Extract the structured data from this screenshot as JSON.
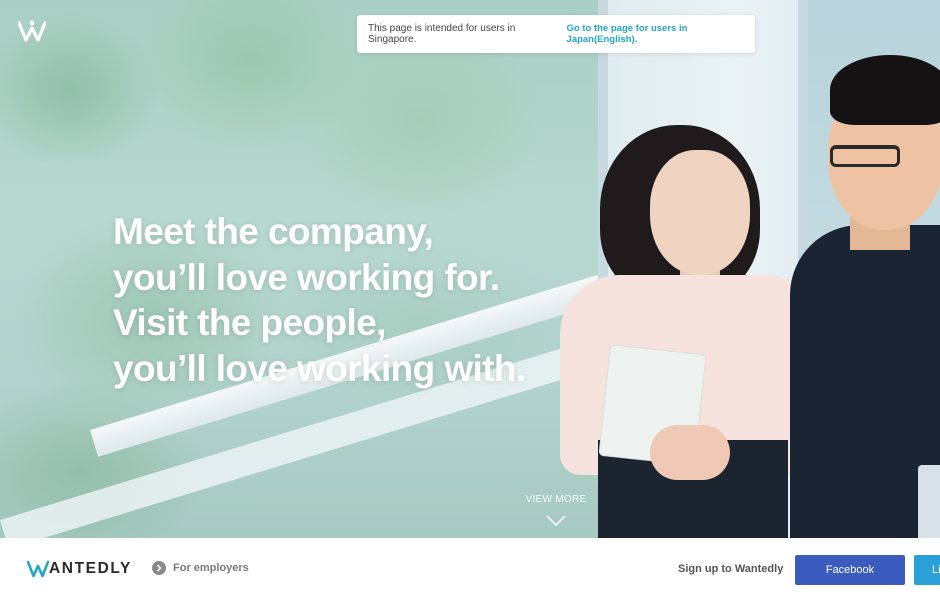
{
  "notice": {
    "text": "This page is intended for users in Singapore.",
    "link_label": "Go to the page for users in Japan(English)."
  },
  "hero": {
    "headline_lines": [
      "Meet the company,",
      "you’ll love working for.",
      "Visit the people,",
      "you’ll love working with."
    ],
    "view_more_label": "VIEW MORE"
  },
  "footer": {
    "brand_text": "ANTEDLY",
    "employers_label": "For employers",
    "signup_label": "Sign up to Wantedly",
    "facebook_label": "Facebook",
    "linkedin_label": "Li"
  },
  "colors": {
    "link": "#21a5c9",
    "facebook": "#3b5bbe",
    "linkedin": "#2aa0d8",
    "brand_accent": "#21a5c9"
  },
  "icons": {
    "hero_logo": "wantedly-w-logo-icon",
    "view_more": "chevron-down-icon",
    "employers": "chevron-right-circle-icon",
    "brand": "wantedly-w-logo-icon"
  }
}
